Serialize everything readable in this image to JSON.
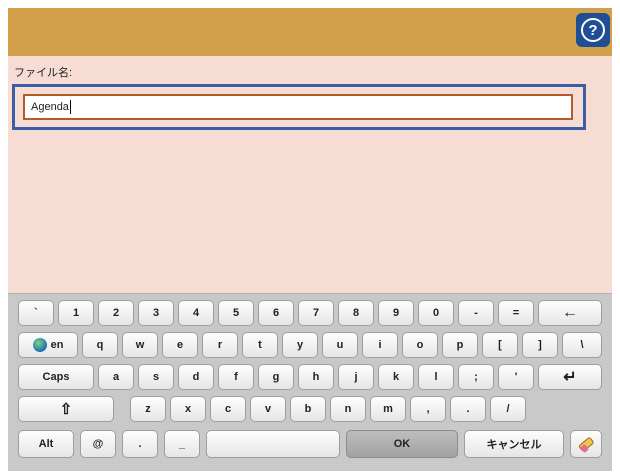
{
  "header": {
    "help_icon": "question-mark-icon",
    "help_glyph": "?"
  },
  "form": {
    "label": "ファイル名:",
    "value": "Agenda"
  },
  "keyboard": {
    "row1": [
      "`",
      "1",
      "2",
      "3",
      "4",
      "5",
      "6",
      "7",
      "8",
      "9",
      "0",
      "-",
      "="
    ],
    "backspace": "←",
    "language": "en",
    "row2": [
      "q",
      "w",
      "e",
      "r",
      "t",
      "y",
      "u",
      "i",
      "o",
      "p",
      "[",
      "]",
      "\\"
    ],
    "caps": "Caps",
    "row3": [
      "a",
      "s",
      "d",
      "f",
      "g",
      "h",
      "j",
      "k",
      "l",
      ";",
      "'"
    ],
    "enter": "↵",
    "shift": "⇧",
    "row4": [
      "z",
      "x",
      "c",
      "v",
      "b",
      "n",
      "m",
      ",",
      ".",
      "/"
    ],
    "alt": "Alt",
    "at": "@",
    "dot": ".",
    "underscore": "_",
    "space": "",
    "ok": "OK",
    "cancel": "キャンセル",
    "clear_icon": "eraser-icon"
  },
  "colors": {
    "header": "#d2a04a",
    "panel": "#f6dcd2",
    "help": "#1f4e94",
    "field_outline": "#3b5ea9",
    "input_border": "#b45b2c"
  }
}
